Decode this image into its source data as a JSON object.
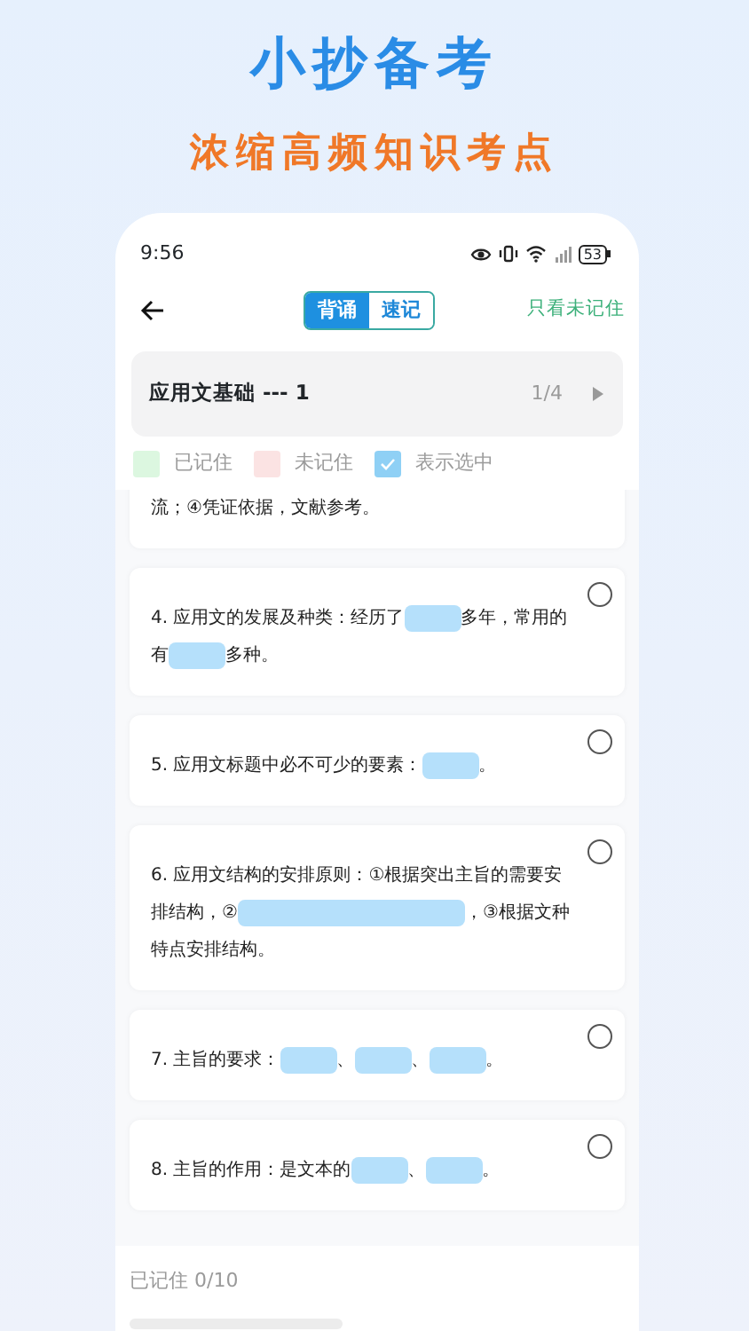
{
  "hero": {
    "title": "小抄备考",
    "subtitle": "浓缩高频知识考点"
  },
  "status_bar": {
    "time": "9:56",
    "battery": "53"
  },
  "header": {
    "tabs": [
      {
        "label": "背诵",
        "selected": true
      },
      {
        "label": "速记",
        "selected": false
      }
    ],
    "filter_link": "只看未记住"
  },
  "topic": {
    "title": "应用文基础 --- 1",
    "page": "1/4"
  },
  "legend": [
    {
      "kind": "swatch",
      "label": "已记住",
      "color": "#dcf7e0"
    },
    {
      "kind": "swatch",
      "label": "未记住",
      "color": "#fbe3e3"
    },
    {
      "kind": "check",
      "label": "表示选中",
      "color": "#8fd0f5"
    }
  ],
  "cards": [
    {
      "segments": [
        {
          "kind": "text",
          "text": "流；④凭证依据，文献参考。"
        }
      ]
    },
    {
      "selected": false,
      "segments": [
        {
          "kind": "text",
          "text": "4. 应用文的发展及种类：经历了"
        },
        {
          "kind": "blank"
        },
        {
          "kind": "text",
          "text": "多年，常用的有"
        },
        {
          "kind": "blank"
        },
        {
          "kind": "text",
          "text": "多种。"
        }
      ]
    },
    {
      "selected": false,
      "segments": [
        {
          "kind": "text",
          "text": "5. 应用文标题中必不可少的要素："
        },
        {
          "kind": "blank"
        },
        {
          "kind": "text",
          "text": "。"
        }
      ]
    },
    {
      "selected": false,
      "segments": [
        {
          "kind": "text",
          "text": "6. 应用文结构的安排原则：①根据突出主旨的需要安排结构，②"
        },
        {
          "kind": "wide_blank"
        },
        {
          "kind": "text",
          "text": "，③根据文种特点安排结构。"
        }
      ]
    },
    {
      "selected": false,
      "segments": [
        {
          "kind": "text",
          "text": "7. 主旨的要求："
        },
        {
          "kind": "blank"
        },
        {
          "kind": "text",
          "text": "、"
        },
        {
          "kind": "blank"
        },
        {
          "kind": "text",
          "text": "、"
        },
        {
          "kind": "blank"
        },
        {
          "kind": "text",
          "text": "。"
        }
      ]
    },
    {
      "selected": false,
      "segments": [
        {
          "kind": "text",
          "text": "8. 主旨的作用：是文本的"
        },
        {
          "kind": "blank"
        },
        {
          "kind": "text",
          "text": "、"
        },
        {
          "kind": "blank"
        },
        {
          "kind": "text",
          "text": "。"
        }
      ]
    }
  ],
  "footer": {
    "progress": "已记住 0/10"
  }
}
